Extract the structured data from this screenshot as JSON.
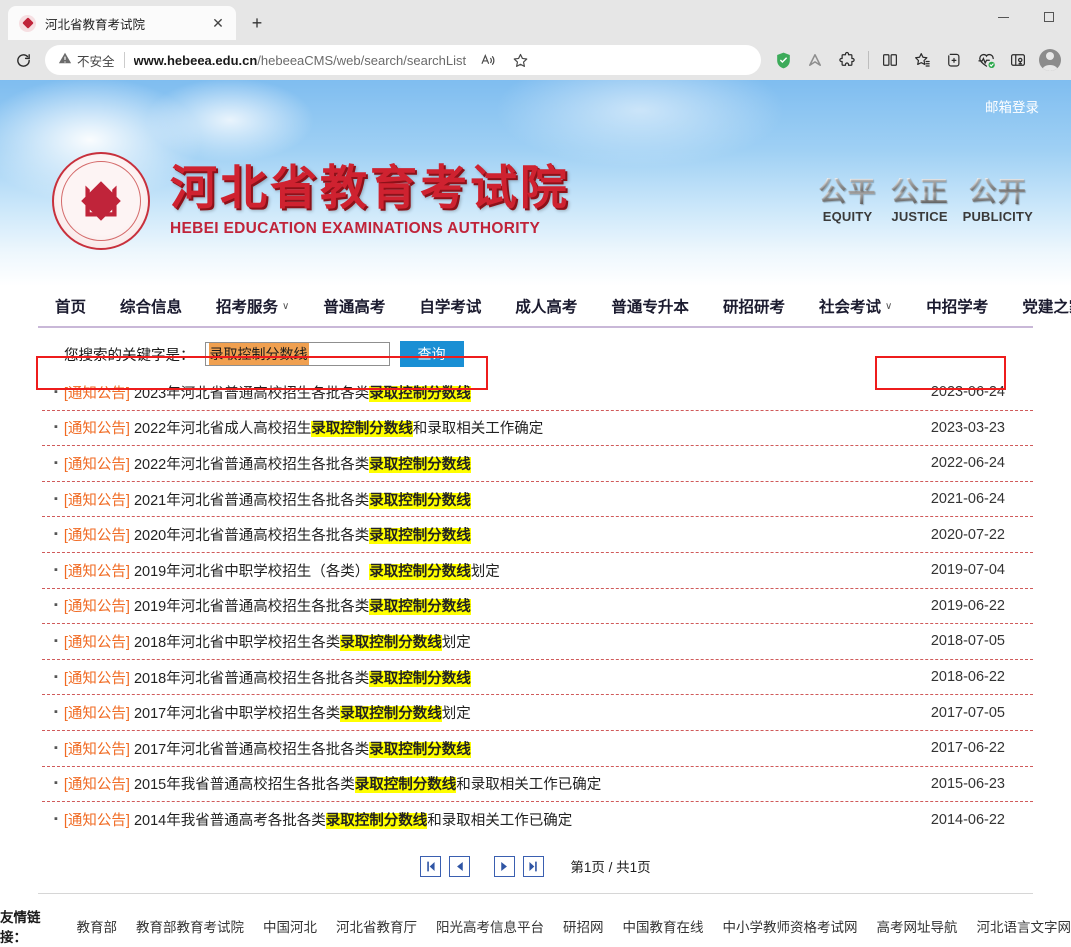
{
  "browser": {
    "tab": {
      "title": "河北省教育考试院",
      "favicon": "site-favicon",
      "close": "✕"
    },
    "new_tab": "+",
    "window": {
      "minimize": "minimize",
      "maximize": "maximize"
    },
    "reload": "reload-icon",
    "omnibox": {
      "security_warning": "不安全",
      "url_host": "www.hebeea.edu.cn",
      "url_path": "/hebeeaCMS/web/search/searchList"
    },
    "toolbar_icons": [
      "read-aloud-icon",
      "favorite-star-icon",
      "adguard-shield-icon",
      "brave-leo-icon",
      "extensions-puzzle-icon",
      "split-screen-icon",
      "collections-icon",
      "add-to-collection-icon",
      "performance-icon",
      "browser-essentials-icon",
      "profile-avatar"
    ]
  },
  "site": {
    "mail_login": "邮箱登录",
    "title_cn": "河北省教育考试院",
    "title_en": "HEBEI EDUCATION EXAMINATIONS AUTHORITY",
    "emblems": [
      {
        "cn": "公平",
        "en": "EQUITY"
      },
      {
        "cn": "公正",
        "en": "JUSTICE"
      },
      {
        "cn": "公开",
        "en": "PUBLICITY"
      }
    ],
    "nav": [
      {
        "label": "首页",
        "dropdown": false
      },
      {
        "label": "综合信息",
        "dropdown": false
      },
      {
        "label": "招考服务",
        "dropdown": true
      },
      {
        "label": "普通高考",
        "dropdown": false
      },
      {
        "label": "自学考试",
        "dropdown": false
      },
      {
        "label": "成人高考",
        "dropdown": false
      },
      {
        "label": "普通专升本",
        "dropdown": false
      },
      {
        "label": "研招研考",
        "dropdown": false
      },
      {
        "label": "社会考试",
        "dropdown": true
      },
      {
        "label": "中招学考",
        "dropdown": false
      },
      {
        "label": "党建之家",
        "dropdown": false
      }
    ]
  },
  "search": {
    "label": "您搜索的关键字是：",
    "value": "录取控制分数线",
    "button": "查询",
    "keyword": "录取控制分数线"
  },
  "results": [
    {
      "tag": "[通知公告]",
      "pre": "2023年河北省普通高校招生各批各类",
      "hl": "录取控制分数线",
      "post": "",
      "date": "2023-06-24"
    },
    {
      "tag": "[通知公告]",
      "pre": "2022年河北省成人高校招生",
      "hl": "录取控制分数线",
      "post": "和录取相关工作确定",
      "date": "2023-03-23"
    },
    {
      "tag": "[通知公告]",
      "pre": "2022年河北省普通高校招生各批各类",
      "hl": "录取控制分数线",
      "post": "",
      "date": "2022-06-24"
    },
    {
      "tag": "[通知公告]",
      "pre": "2021年河北省普通高校招生各批各类",
      "hl": "录取控制分数线",
      "post": "",
      "date": "2021-06-24"
    },
    {
      "tag": "[通知公告]",
      "pre": "2020年河北省普通高校招生各批各类",
      "hl": "录取控制分数线",
      "post": "",
      "date": "2020-07-22"
    },
    {
      "tag": "[通知公告]",
      "pre": "2019年河北省中职学校招生（各类）",
      "hl": "录取控制分数线",
      "post": "划定",
      "date": "2019-07-04"
    },
    {
      "tag": "[通知公告]",
      "pre": "2019年河北省普通高校招生各批各类",
      "hl": "录取控制分数线",
      "post": "",
      "date": "2019-06-22"
    },
    {
      "tag": "[通知公告]",
      "pre": "2018年河北省中职学校招生各类",
      "hl": "录取控制分数线",
      "post": "划定",
      "date": "2018-07-05"
    },
    {
      "tag": "[通知公告]",
      "pre": "2018年河北省普通高校招生各批各类",
      "hl": "录取控制分数线",
      "post": "",
      "date": "2018-06-22"
    },
    {
      "tag": "[通知公告]",
      "pre": "2017年河北省中职学校招生各类",
      "hl": "录取控制分数线",
      "post": "划定",
      "date": "2017-07-05"
    },
    {
      "tag": "[通知公告]",
      "pre": "2017年河北省普通高校招生各批各类",
      "hl": "录取控制分数线",
      "post": "",
      "date": "2017-06-22"
    },
    {
      "tag": "[通知公告]",
      "pre": "2015年我省普通高校招生各批各类",
      "hl": "录取控制分数线",
      "post": "和录取相关工作已确定",
      "date": "2015-06-23"
    },
    {
      "tag": "[通知公告]",
      "pre": "2014年我省普通高考各批各类",
      "hl": "录取控制分数线",
      "post": "和录取相关工作已确定",
      "date": "2014-06-22"
    }
  ],
  "pagination": {
    "first": "first-page-icon",
    "prev": "prev-page-icon",
    "next": "next-page-icon",
    "last": "last-page-icon",
    "status": "第1页 / 共1页"
  },
  "footer": {
    "label": "友情链接：",
    "links": [
      "教育部",
      "教育部教育考试院",
      "中国河北",
      "河北省教育厅",
      "阳光高考信息平台",
      "研招网",
      "中国教育在线",
      "中小学教师资格考试网",
      "高考网址导航",
      "河北语言文字网"
    ]
  },
  "colors": {
    "accent_red": "#cf2230",
    "highlight_yellow": "#ffff00",
    "selection_orange": "#f0a050",
    "button_blue": "#1a8fd4",
    "tag_orange": "#f06a22",
    "annotation_red": "#ee1c1c"
  }
}
